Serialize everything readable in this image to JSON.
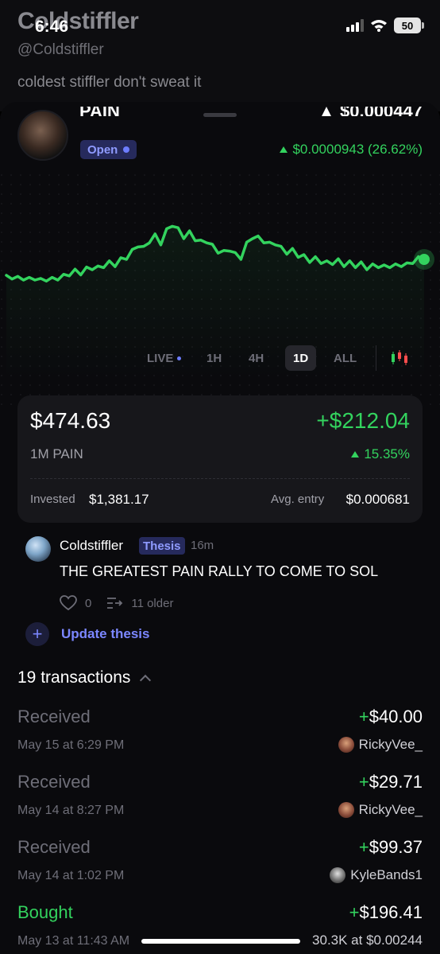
{
  "status_bar": {
    "time": "6:46",
    "battery": "50"
  },
  "profile": {
    "name": "Coldstiffler",
    "handle": "@Coldstiffler",
    "bio": "coldest stiffler don't sweat it"
  },
  "token": {
    "name_partial": "PAIN",
    "status_badge": "Open",
    "price_change": "$0.0000943 (26.62%)"
  },
  "chart_data": {
    "type": "line",
    "timeframe": "1D",
    "color": "#33d35e",
    "y_values": [
      0.3,
      0.31,
      0.29,
      0.3,
      0.28,
      0.3,
      0.27,
      0.29,
      0.28,
      0.3,
      0.31,
      0.34,
      0.36,
      0.35,
      0.38,
      0.4,
      0.39,
      0.42,
      0.44,
      0.43,
      0.47,
      0.5,
      0.55,
      0.62,
      0.58,
      0.66,
      0.7,
      0.64,
      0.75,
      0.82,
      0.76,
      0.7,
      0.73,
      0.68,
      0.64,
      0.66,
      0.6,
      0.56,
      0.54,
      0.58,
      0.52,
      0.5,
      0.62,
      0.7,
      0.68,
      0.66,
      0.62,
      0.64,
      0.58,
      0.55,
      0.56,
      0.52,
      0.5,
      0.47,
      0.48,
      0.46,
      0.44,
      0.45,
      0.46,
      0.43,
      0.44,
      0.42,
      0.43,
      0.4,
      0.41,
      0.42,
      0.4,
      0.42,
      0.41,
      0.43,
      0.42,
      0.46,
      0.48,
      0.5
    ],
    "end_marker": true
  },
  "range_tabs": [
    {
      "label": "LIVE",
      "active": false
    },
    {
      "label": "1H",
      "active": false
    },
    {
      "label": "4H",
      "active": false
    },
    {
      "label": "1D",
      "active": true
    },
    {
      "label": "ALL",
      "active": false
    }
  ],
  "position": {
    "value": "$474.63",
    "pnl": "+$212.04",
    "quantity": "1M PAIN",
    "pnl_pct": "15.35%",
    "invested_label": "Invested",
    "invested": "$1,381.17",
    "avg_entry_label": "Avg. entry",
    "avg_entry": "$0.000681"
  },
  "thesis": {
    "user": "Coldstiffler",
    "badge": "Thesis",
    "time": "16m",
    "text": "THE GREATEST PAIN RALLY TO COME TO SOL",
    "likes": "0",
    "older": "11 older",
    "update_label": "Update thesis"
  },
  "transactions": {
    "header": "19 transactions",
    "items": [
      {
        "type": "Received",
        "amount": "$40.00",
        "date": "May 15 at 6:29 PM",
        "counterparty": "RickyVee_"
      },
      {
        "type": "Received",
        "amount": "$29.71",
        "date": "May 14 at 8:27 PM",
        "counterparty": "RickyVee_"
      },
      {
        "type": "Received",
        "amount": "$99.37",
        "date": "May 14 at 1:02 PM",
        "counterparty": "KyleBands1"
      },
      {
        "type": "Bought",
        "amount": "$196.41",
        "date": "May 13 at 11:43 AM",
        "counterparty": "30.3K at $0.00244"
      }
    ]
  },
  "colors": {
    "green": "#33d35e",
    "accent": "#7b87ff",
    "card": "#17171b"
  }
}
